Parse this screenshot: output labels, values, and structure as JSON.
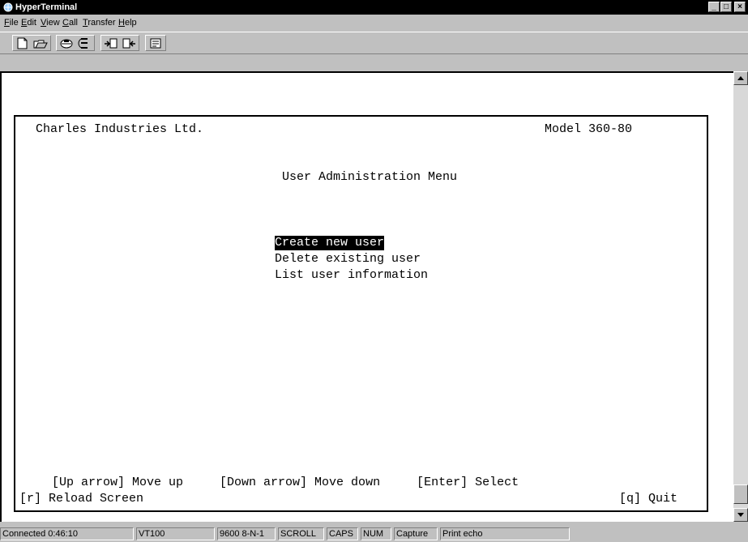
{
  "window": {
    "title": "HyperTerminal"
  },
  "menu": [
    "File",
    "Edit",
    "View",
    "Call",
    "Transfer",
    "Help"
  ],
  "menu_mnemonics": [
    "F",
    "E",
    "V",
    "C",
    "T",
    "H"
  ],
  "menu_rest": [
    "ile",
    "dit",
    "iew",
    "all",
    "ransfer",
    "elp"
  ],
  "toolbar": {
    "buttons": [
      "new-document-icon",
      "open-folder-icon",
      "connect-icon",
      "disconnect-icon",
      "send-icon",
      "receive-icon",
      "properties-icon"
    ]
  },
  "terminal": {
    "company": "Charles Industries Ltd.",
    "model": "Model 360-80",
    "menu_title": "User Administration Menu",
    "options": [
      "Create new user",
      "Delete existing user",
      "List user information"
    ],
    "selected_index": 0,
    "help_line": "[Up arrow] Move up     [Down arrow] Move down     [Enter] Select",
    "reload": "[r] Reload Screen",
    "quit": "[q] Quit"
  },
  "status": {
    "connected": "Connected 0:46:10",
    "emulation": "VT100",
    "settings": "9600 8-N-1",
    "scroll": "SCROLL",
    "caps": "CAPS",
    "num": "NUM",
    "capture": "Capture",
    "print_echo": "Print echo"
  }
}
